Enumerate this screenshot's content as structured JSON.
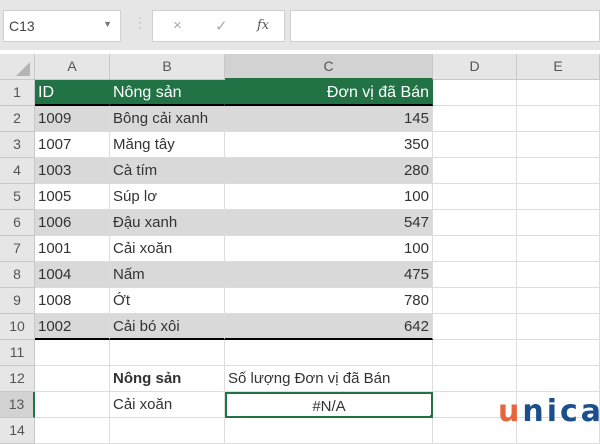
{
  "name_box": "C13",
  "formula_bar": {
    "cancel_icon": "×",
    "enter_icon": "✓",
    "fx_label": "fx",
    "value": ""
  },
  "columns": [
    "A",
    "B",
    "C",
    "D",
    "E"
  ],
  "header": {
    "row": "1",
    "id": "ID",
    "product": "Nông sản",
    "units": "Đơn vị đã Bán"
  },
  "rows": [
    {
      "row": "2",
      "id": "1009",
      "product": "Bông cải xanh",
      "units": "145"
    },
    {
      "row": "3",
      "id": "1007",
      "product": "Măng tây",
      "units": "350"
    },
    {
      "row": "4",
      "id": "1003",
      "product": "Cà tím",
      "units": "280"
    },
    {
      "row": "5",
      "id": "1005",
      "product": "Súp lơ",
      "units": "100"
    },
    {
      "row": "6",
      "id": "1006",
      "product": "Đậu xanh",
      "units": "547"
    },
    {
      "row": "7",
      "id": "1001",
      "product": "Cải xoăn",
      "units": "100"
    },
    {
      "row": "8",
      "id": "1004",
      "product": "Nấm",
      "units": "475"
    },
    {
      "row": "9",
      "id": "1008",
      "product": "Ớt",
      "units": "780"
    },
    {
      "row": "10",
      "id": "1002",
      "product": "Cải bó xôi",
      "units": "642"
    }
  ],
  "lookup": {
    "row11": "11",
    "row12": "12",
    "row13": "13",
    "row14": "14",
    "label_product": "Nông sản",
    "label_units": "Số lượng Đơn vị đã Bán",
    "product": "Cải xoăn",
    "result": "#N/A"
  },
  "logo": {
    "u": "u",
    "rest": "nica"
  },
  "colors": {
    "accent": "#217346",
    "stripe": "#d9d9d9"
  }
}
